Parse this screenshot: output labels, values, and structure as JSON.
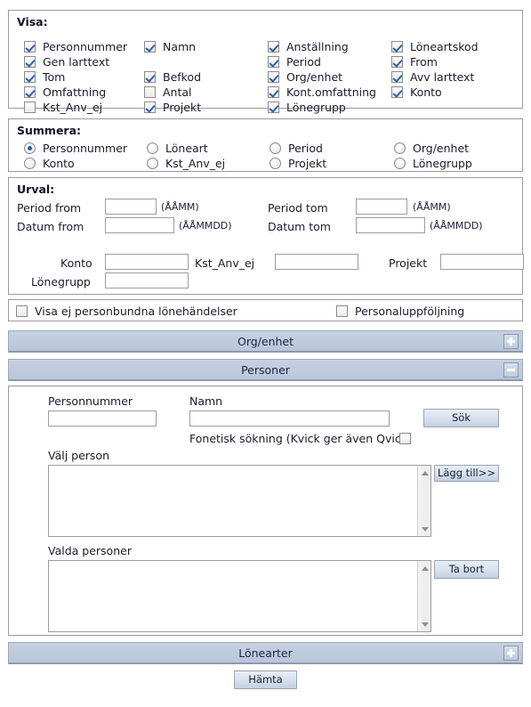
{
  "visa": {
    "title": "Visa:",
    "columns": [
      [
        {
          "label": "Personnummer",
          "checked": true
        },
        {
          "label": "Gen larttext",
          "checked": true
        },
        {
          "label": "Tom",
          "checked": true
        },
        {
          "label": "Omfattning",
          "checked": true
        },
        {
          "label": "Kst_Anv_ej",
          "checked": false
        }
      ],
      [
        {
          "label": "Namn",
          "checked": true
        },
        {
          "label": "",
          "checked": null
        },
        {
          "label": "Befkod",
          "checked": true
        },
        {
          "label": "Antal",
          "checked": false
        },
        {
          "label": "Projekt",
          "checked": true
        }
      ],
      [
        {
          "label": "Anställning",
          "checked": true
        },
        {
          "label": "Period",
          "checked": true
        },
        {
          "label": "Org/enhet",
          "checked": true
        },
        {
          "label": "Kont.omfattning",
          "checked": true
        },
        {
          "label": "Lönegrupp",
          "checked": true
        }
      ],
      [
        {
          "label": "Löneartskod",
          "checked": true
        },
        {
          "label": "From",
          "checked": true
        },
        {
          "label": "Avv larttext",
          "checked": true
        },
        {
          "label": "Konto",
          "checked": true
        },
        {
          "label": "",
          "checked": null
        }
      ]
    ]
  },
  "summera": {
    "title": "Summera:",
    "columns": [
      [
        {
          "label": "Personnummer",
          "selected": true
        },
        {
          "label": "Konto",
          "selected": false
        }
      ],
      [
        {
          "label": "Löneart",
          "selected": false
        },
        {
          "label": "Kst_Anv_ej",
          "selected": false
        }
      ],
      [
        {
          "label": "Period",
          "selected": false
        },
        {
          "label": "Projekt",
          "selected": false
        }
      ],
      [
        {
          "label": "Org/enhet",
          "selected": false
        },
        {
          "label": "Lönegrupp",
          "selected": false
        }
      ]
    ]
  },
  "urval": {
    "title": "Urval:",
    "period_from_label": "Period from",
    "period_from_value": "",
    "period_from_hint": "(ÅÅMM)",
    "period_tom_label": "Period tom",
    "period_tom_value": "",
    "period_tom_hint": "(ÅÅMM)",
    "datum_from_label": "Datum from",
    "datum_from_value": "",
    "datum_from_hint": "(ÅÅMMDD)",
    "datum_tom_label": "Datum tom",
    "datum_tom_value": "",
    "datum_tom_hint": "(ÅÅMMDD)",
    "konto_label": "Konto",
    "konto_value": "",
    "kst_label": "Kst_Anv_ej",
    "kst_value": "",
    "projekt_label": "Projekt",
    "projekt_value": "",
    "lonegrupp_label": "Lönegrupp",
    "lonegrupp_value": ""
  },
  "flags": {
    "visa_ej_label": "Visa ej personbundna lönehändelser",
    "visa_ej_checked": false,
    "personaluppfoljning_label": "Personaluppföljning",
    "personaluppfoljning_checked": false
  },
  "sections": {
    "orgenhet": {
      "title": "Org/enhet",
      "state": "collapsed",
      "toggle_icon": "plus-icon"
    },
    "personer": {
      "title": "Personer",
      "state": "expanded",
      "toggle_icon": "minus-icon"
    },
    "lonearter": {
      "title": "Lönearter",
      "state": "collapsed",
      "toggle_icon": "plus-icon"
    }
  },
  "personer": {
    "personnummer_label": "Personnummer",
    "personnummer_value": "",
    "namn_label": "Namn",
    "namn_value": "",
    "sok_button": "Sök",
    "fonetisk_label": "Fonetisk sökning (Kvick ger även Qvick)",
    "fonetisk_checked": false,
    "valj_person_label": "Välj person",
    "valj_person_items": [],
    "lagg_till_button": "Lägg till>>",
    "valda_personer_label": "Valda personer",
    "valda_personer_items": [],
    "ta_bort_button": "Ta bort"
  },
  "footer": {
    "hamta_button": "Hämta"
  },
  "colors": {
    "section_bar": "#bcc9dd",
    "button_face": "#d5deec",
    "panel_border": "#9a9a9a",
    "check_blue": "#2f5fa8",
    "radio_blue": "#1d5fb4"
  }
}
